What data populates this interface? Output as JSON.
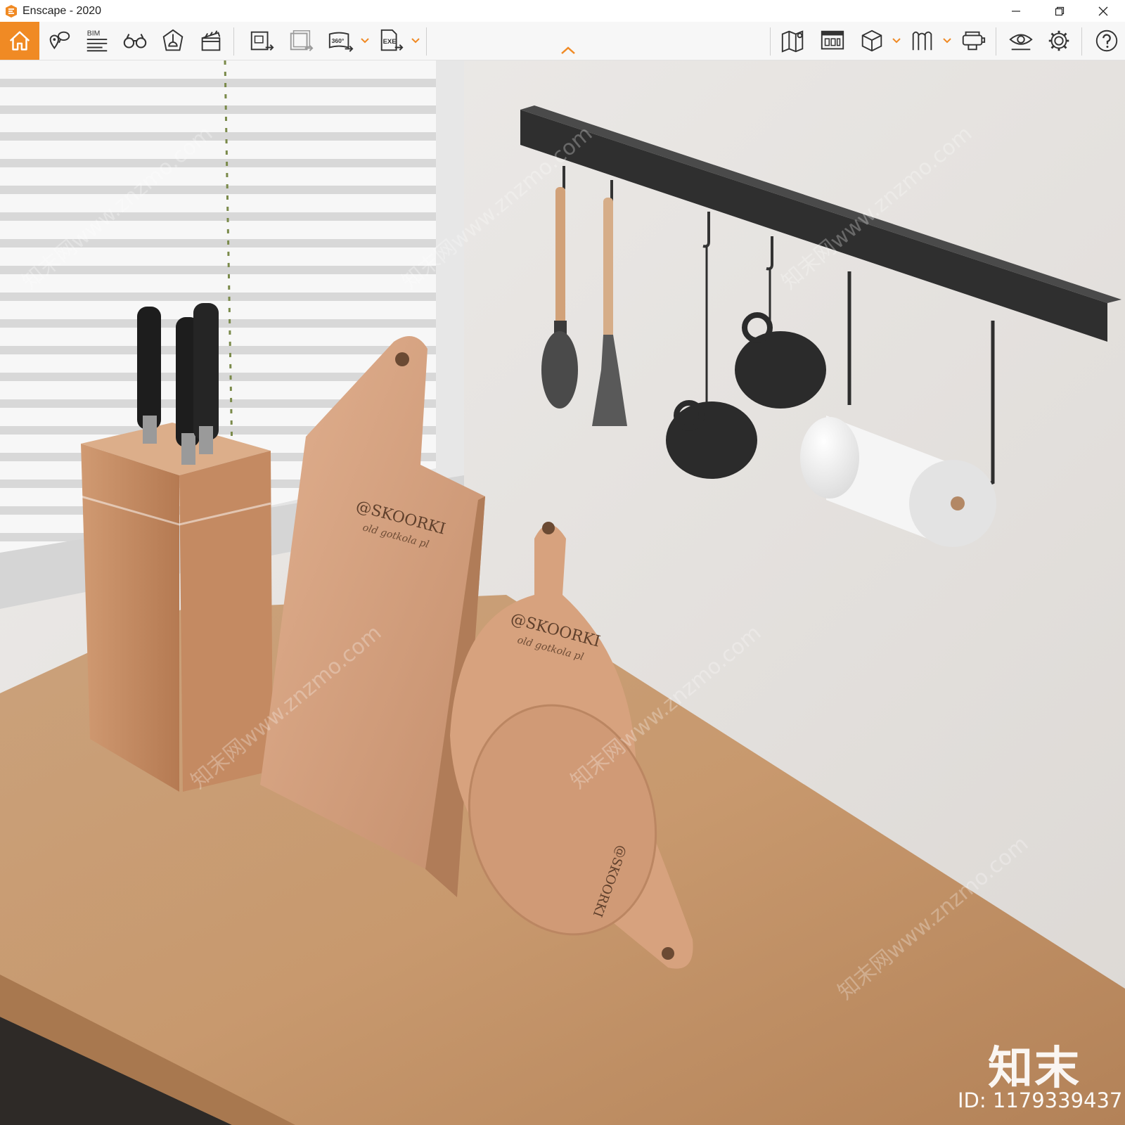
{
  "window": {
    "title": "Enscape - 2020",
    "accent_color": "#f08a24"
  },
  "toolbar": {
    "bim_label": "BIM",
    "panorama_label": "360°",
    "exe_label": "EXE",
    "left_icons": [
      "home-icon",
      "place-marker-icon",
      "bim-info-icon",
      "binoculars-icon",
      "perspective-icon",
      "clapperboard-icon",
      "screenshot-export-icon",
      "batch-render-icon",
      "panorama-360-icon",
      "exe-export-icon"
    ],
    "right_icons": [
      "map-icon",
      "capture-icon",
      "asset-cube-icon",
      "asset-library-icon",
      "vr-headset-icon",
      "visual-settings-icon",
      "settings-icon",
      "help-icon"
    ]
  },
  "scene": {
    "board_brand": "@SKOORKI",
    "board_subtitle": "old gotkola pl",
    "watermark_logo": "知末",
    "watermark_id": "ID: 1179339437",
    "watermark_tile": "知末网www.znzmo.com"
  }
}
